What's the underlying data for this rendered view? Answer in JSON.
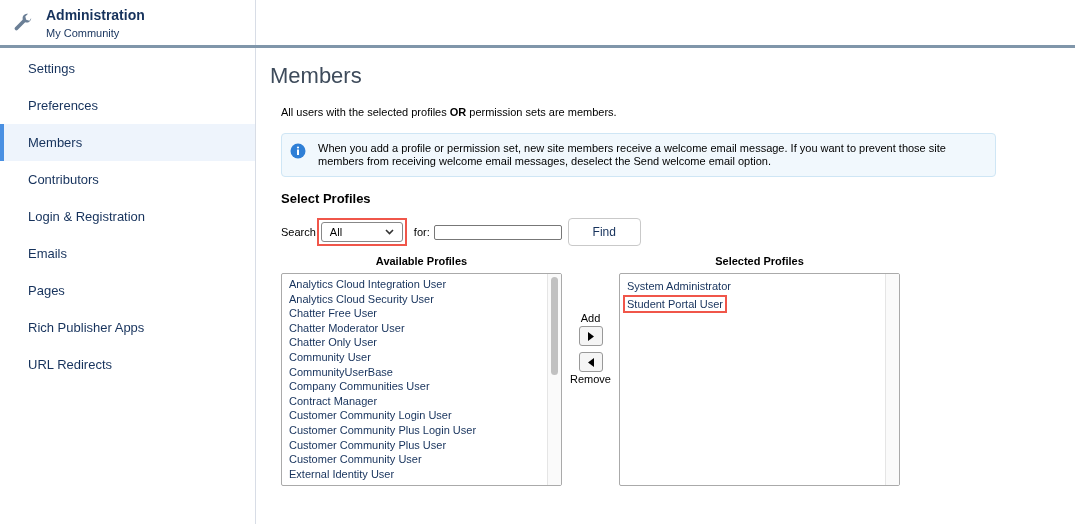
{
  "header": {
    "title": "Administration",
    "subtitle": "My Community"
  },
  "sidebar": {
    "items": [
      {
        "label": "Settings",
        "selected": false
      },
      {
        "label": "Preferences",
        "selected": false
      },
      {
        "label": "Members",
        "selected": true
      },
      {
        "label": "Contributors",
        "selected": false
      },
      {
        "label": "Login & Registration",
        "selected": false
      },
      {
        "label": "Emails",
        "selected": false
      },
      {
        "label": "Pages",
        "selected": false
      },
      {
        "label": "Rich Publisher Apps",
        "selected": false
      },
      {
        "label": "URL Redirects",
        "selected": false
      }
    ]
  },
  "page": {
    "title": "Members",
    "intro": "All users with the selected profiles **OR** permission sets are members.",
    "info": "When you add a profile or permission set, new site members receive a welcome email message. If you want to prevent those site members from receiving welcome email messages, deselect the Send welcome email option.",
    "section_title": "Select Profiles",
    "search": {
      "label": "Search",
      "value": "All",
      "highlighted": true,
      "for_label": "for:",
      "button": "Find"
    },
    "available": {
      "title": "Available Profiles",
      "items": [
        "Analytics Cloud Integration User",
        "Analytics Cloud Security User",
        "Chatter Free User",
        "Chatter Moderator User",
        "Chatter Only User",
        "Community User",
        "CommunityUserBase",
        "Company Communities User",
        "Contract Manager",
        "Customer Community Login User",
        "Customer Community Plus Login User",
        "Customer Community Plus User",
        "Customer Community User",
        "External Identity User"
      ]
    },
    "add_label": "Add",
    "remove_label": "Remove",
    "selected": {
      "title": "Selected Profiles",
      "items": [
        {
          "label": "System Administrator",
          "highlighted": false
        },
        {
          "label": "Student Portal User",
          "highlighted": true
        }
      ]
    }
  }
}
